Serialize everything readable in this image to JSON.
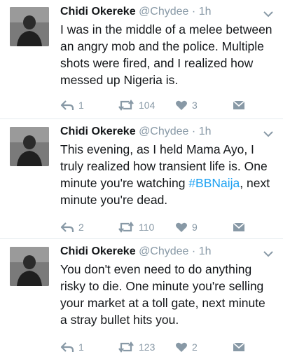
{
  "tweets": [
    {
      "name": "Chidi Okereke",
      "handle": "@Chydee",
      "dot": "·",
      "time": "1h",
      "text_before": "I was in the middle of a melee between an angry mob and the police. Multiple shots were fired, and I realized how messed up Nigeria is.",
      "hashtag": "",
      "text_after": "",
      "replies": "1",
      "retweets": "104",
      "likes": "3"
    },
    {
      "name": "Chidi Okereke",
      "handle": "@Chydee",
      "dot": "·",
      "time": "1h",
      "text_before": "This evening, as I held Mama Ayo, I truly realized how transient life is. One minute you're watching ",
      "hashtag": "#BBNaija",
      "text_after": ", next minute you're dead.",
      "replies": "2",
      "retweets": "110",
      "likes": "9"
    },
    {
      "name": "Chidi Okereke",
      "handle": "@Chydee",
      "dot": "·",
      "time": "1h",
      "text_before": "You don't even need to do anything risky to die. One minute you're selling your market at a toll gate, next minute a stray bullet hits you.",
      "hashtag": "",
      "text_after": "",
      "replies": "1",
      "retweets": "123",
      "likes": "2"
    }
  ],
  "icons": {
    "reply": "reply-icon",
    "retweet": "retweet-icon",
    "like": "heart-icon",
    "dm": "envelope-icon",
    "more": "chevron-down-icon"
  },
  "colors": {
    "text": "#14171a",
    "muted": "#8899a6",
    "hashtag": "#1da1f2"
  }
}
